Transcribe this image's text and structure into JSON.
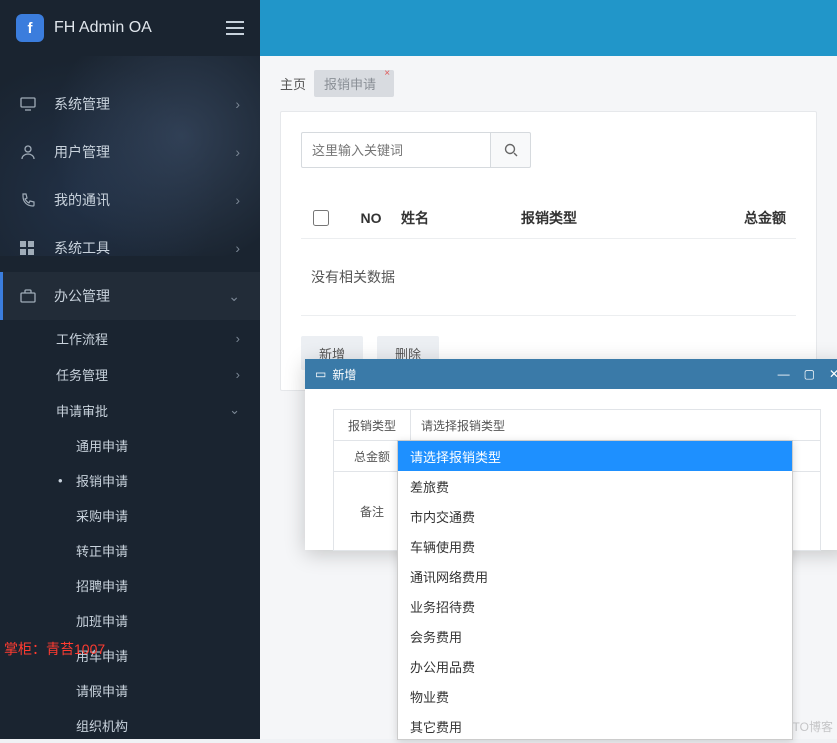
{
  "brand": {
    "logo_letter": "f",
    "title": "FH Admin OA"
  },
  "sidebar": {
    "items": [
      {
        "label": "系统管理",
        "expandable": true
      },
      {
        "label": "用户管理",
        "expandable": true
      },
      {
        "label": "我的通讯",
        "expandable": true
      },
      {
        "label": "系统工具",
        "expandable": true
      },
      {
        "label": "办公管理",
        "expandable": true,
        "active": true
      }
    ],
    "sub_items": [
      {
        "label": "工作流程",
        "expandable": true
      },
      {
        "label": "任务管理",
        "expandable": true
      },
      {
        "label": "申请审批",
        "expandable": true,
        "open": true
      }
    ],
    "sub2_items": [
      {
        "label": "通用申请"
      },
      {
        "label": "报销申请",
        "current": true
      },
      {
        "label": "采购申请"
      },
      {
        "label": "转正申请"
      },
      {
        "label": "招聘申请"
      },
      {
        "label": "加班申请"
      },
      {
        "label": "用车申请"
      },
      {
        "label": "请假申请"
      },
      {
        "label": "组织机构"
      }
    ],
    "watermark": "掌柜：青苔1007"
  },
  "tabs": {
    "home": "主页",
    "active": "报销申请"
  },
  "search": {
    "placeholder": "这里输入关键词"
  },
  "table": {
    "headers": {
      "no": "NO",
      "name": "姓名",
      "type": "报销类型",
      "amount": "总金额"
    },
    "empty": "没有相关数据"
  },
  "buttons": {
    "add": "新增",
    "delete": "删除"
  },
  "dialog": {
    "title": "新增",
    "fields": {
      "type_label": "报销类型",
      "type_value": "请选择报销类型",
      "amount_label": "总金额",
      "note_label": "备注"
    },
    "options": [
      "请选择报销类型",
      "差旅费",
      "市内交通费",
      "车辆使用费",
      "通讯网络费用",
      "业务招待费",
      "会务费用",
      "办公用品费",
      "物业费",
      "其它费用"
    ]
  },
  "corner": "@51CTO博客"
}
